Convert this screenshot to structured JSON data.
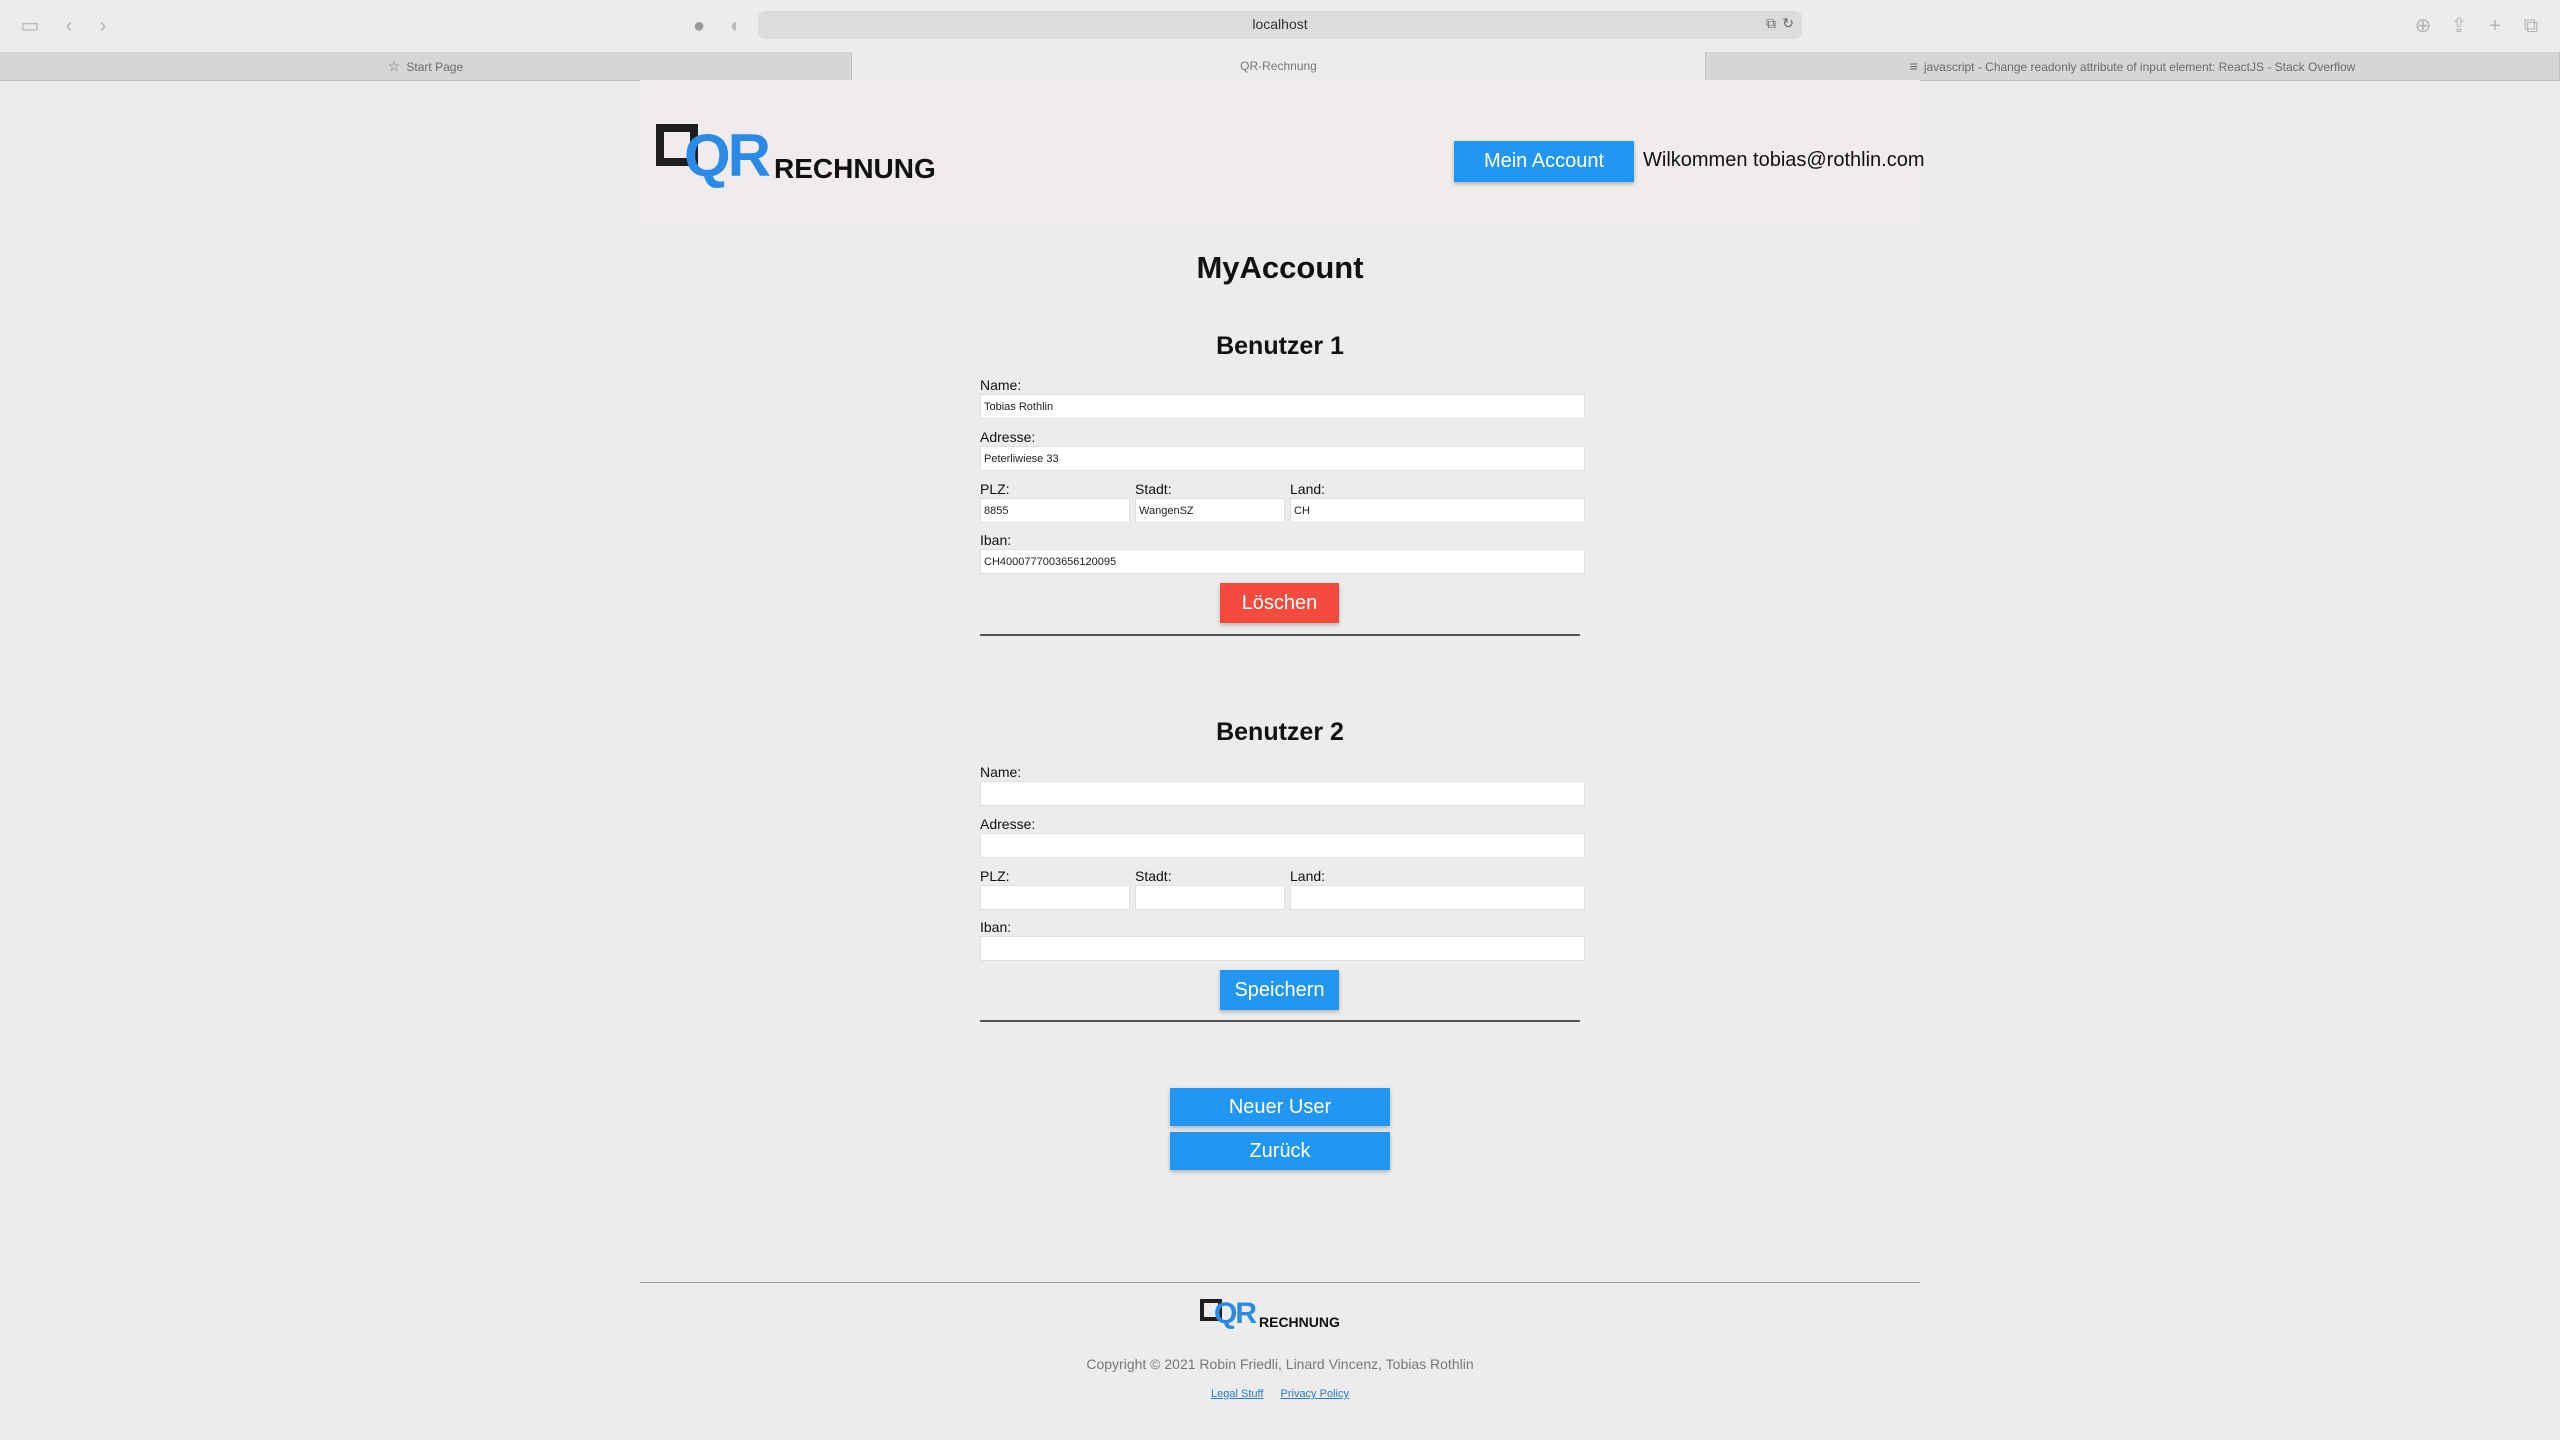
{
  "browser": {
    "url": "localhost",
    "tabs": [
      {
        "label": "Start Page",
        "icon": "star-icon"
      },
      {
        "label": "QR-Rechnung",
        "icon": ""
      },
      {
        "label": "javascript - Change readonly attribute of input element: ReactJS - Stack Overflow",
        "icon": "stackoverflow-icon"
      }
    ]
  },
  "header": {
    "logo_qr": "QR",
    "logo_text": "RECHNUNG",
    "account_button": "Mein Account",
    "welcome": "Wilkommen tobias@rothlin.com"
  },
  "page": {
    "title": "MyAccount"
  },
  "labels": {
    "name": "Name:",
    "address": "Adresse:",
    "plz": "PLZ:",
    "city": "Stadt:",
    "country": "Land:",
    "iban": "Iban:"
  },
  "users": [
    {
      "title": "Benutzer 1",
      "name": "Tobias Rothlin",
      "address": "Peterliwiese 33",
      "plz": "8855",
      "city": "WangenSZ",
      "country": "CH",
      "iban": "CH4000777003656120095",
      "action": "Löschen"
    },
    {
      "title": "Benutzer 2",
      "name": "",
      "address": "",
      "plz": "",
      "city": "",
      "country": "",
      "iban": "",
      "action": "Speichern"
    }
  ],
  "buttons": {
    "new_user": "Neuer User",
    "back": "Zurück"
  },
  "footer": {
    "logo_qr": "QR",
    "logo_text": "RECHNUNG",
    "copyright": "Copyright © 2021 Robin Friedli, Linard Vincenz, Tobias Rothlin",
    "links": [
      "Legal Stuff",
      "Privacy Policy"
    ]
  },
  "colors": {
    "primary": "#2196f3",
    "danger": "#f44b3e",
    "header_bg": "#f0eceb",
    "page_bg": "#ececec"
  }
}
